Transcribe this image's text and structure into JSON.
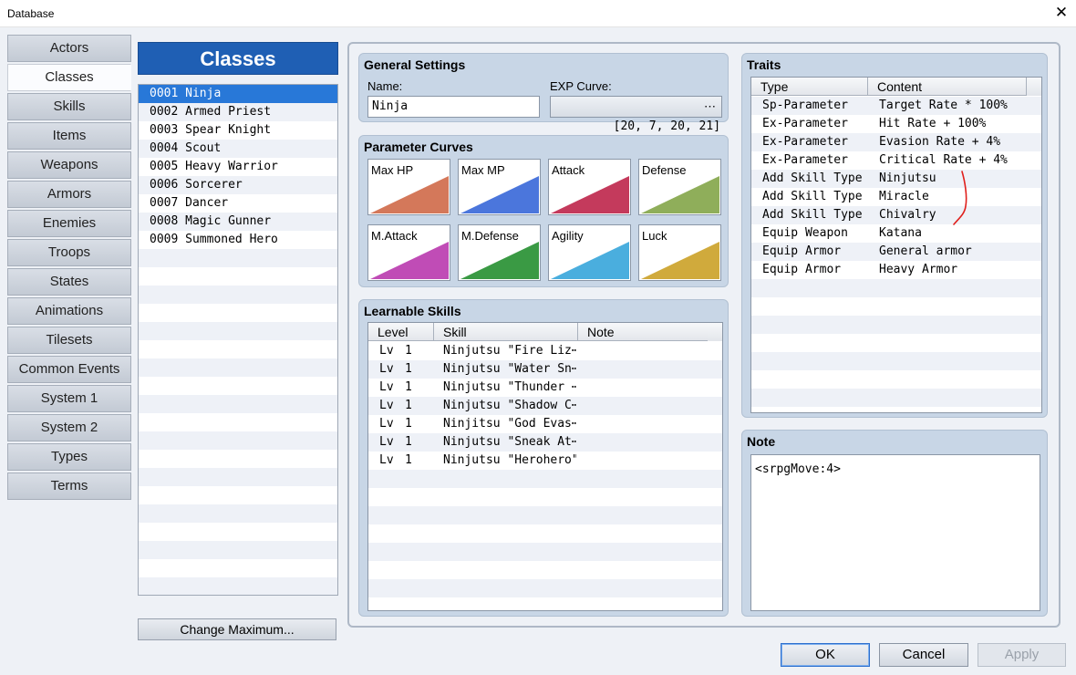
{
  "window": {
    "title": "Database"
  },
  "nav": {
    "tabs": [
      "Actors",
      "Classes",
      "Skills",
      "Items",
      "Weapons",
      "Armors",
      "Enemies",
      "Troops",
      "States",
      "Animations",
      "Tilesets",
      "Common Events",
      "System 1",
      "System 2",
      "Types",
      "Terms"
    ],
    "active": "Classes"
  },
  "classes": {
    "header": "Classes",
    "items": [
      "0001 Ninja",
      "0002 Armed Priest",
      "0003 Spear Knight",
      "0004 Scout",
      "0005 Heavy Warrior",
      "0006 Sorcerer",
      "0007 Dancer",
      "0008 Magic Gunner",
      "0009 Summoned Hero"
    ],
    "selected": "0001 Ninja",
    "change_max_label": "Change Maximum..."
  },
  "general": {
    "title": "General Settings",
    "name_label": "Name:",
    "name_value": "Ninja",
    "exp_label": "EXP Curve:",
    "exp_value": "[20, 7, 20, 21]",
    "exp_button": "⋯"
  },
  "curves": {
    "title": "Parameter Curves",
    "items": [
      {
        "label": "Max HP",
        "color": "#d4785a"
      },
      {
        "label": "Max MP",
        "color": "#4b76dc"
      },
      {
        "label": "Attack",
        "color": "#c43a5c"
      },
      {
        "label": "Defense",
        "color": "#8fae5a"
      },
      {
        "label": "M.Attack",
        "color": "#c04cb6"
      },
      {
        "label": "M.Defense",
        "color": "#3a9a44"
      },
      {
        "label": "Agility",
        "color": "#4aaede"
      },
      {
        "label": "Luck",
        "color": "#d0aa3c"
      }
    ]
  },
  "skills": {
    "title": "Learnable Skills",
    "columns": [
      "Level",
      "Skill",
      "Note"
    ],
    "rows": [
      {
        "lvl": "Lv",
        "num": "1",
        "skill": "Ninjutsu \"Fire Liz⋯"
      },
      {
        "lvl": "Lv",
        "num": "1",
        "skill": "Ninjutsu \"Water Sn⋯"
      },
      {
        "lvl": "Lv",
        "num": "1",
        "skill": "Ninjutsu \"Thunder ⋯"
      },
      {
        "lvl": "Lv",
        "num": "1",
        "skill": "Ninjutsu \"Shadow C⋯"
      },
      {
        "lvl": "Lv",
        "num": "1",
        "skill": "Ninjitsu \"God Evas⋯"
      },
      {
        "lvl": "Lv",
        "num": "1",
        "skill": "Ninjutsu \"Sneak At⋯"
      },
      {
        "lvl": "Lv",
        "num": "1",
        "skill": "Ninjutsu \"Herohero\""
      }
    ]
  },
  "traits": {
    "title": "Traits",
    "columns": [
      "Type",
      "Content"
    ],
    "rows": [
      {
        "type": "Sp-Parameter",
        "content": "Target Rate * 100%"
      },
      {
        "type": "Ex-Parameter",
        "content": "Hit Rate + 100%"
      },
      {
        "type": "Ex-Parameter",
        "content": "Evasion Rate + 4%"
      },
      {
        "type": "Ex-Parameter",
        "content": "Critical Rate + 4%"
      },
      {
        "type": "Add Skill Type",
        "content": "Ninjutsu"
      },
      {
        "type": "Add Skill Type",
        "content": "Miracle"
      },
      {
        "type": "Add Skill Type",
        "content": "Chivalry"
      },
      {
        "type": "Equip Weapon",
        "content": "Katana"
      },
      {
        "type": "Equip Armor",
        "content": "General armor"
      },
      {
        "type": "Equip Armor",
        "content": "Heavy Armor"
      }
    ]
  },
  "note": {
    "title": "Note",
    "value": "<srpgMove:4>"
  },
  "buttons": {
    "ok": "OK",
    "cancel": "Cancel",
    "apply": "Apply"
  },
  "colors": {
    "accent": "#1f5fb4",
    "selection": "#2878d8",
    "annotation": "#e0201c"
  }
}
